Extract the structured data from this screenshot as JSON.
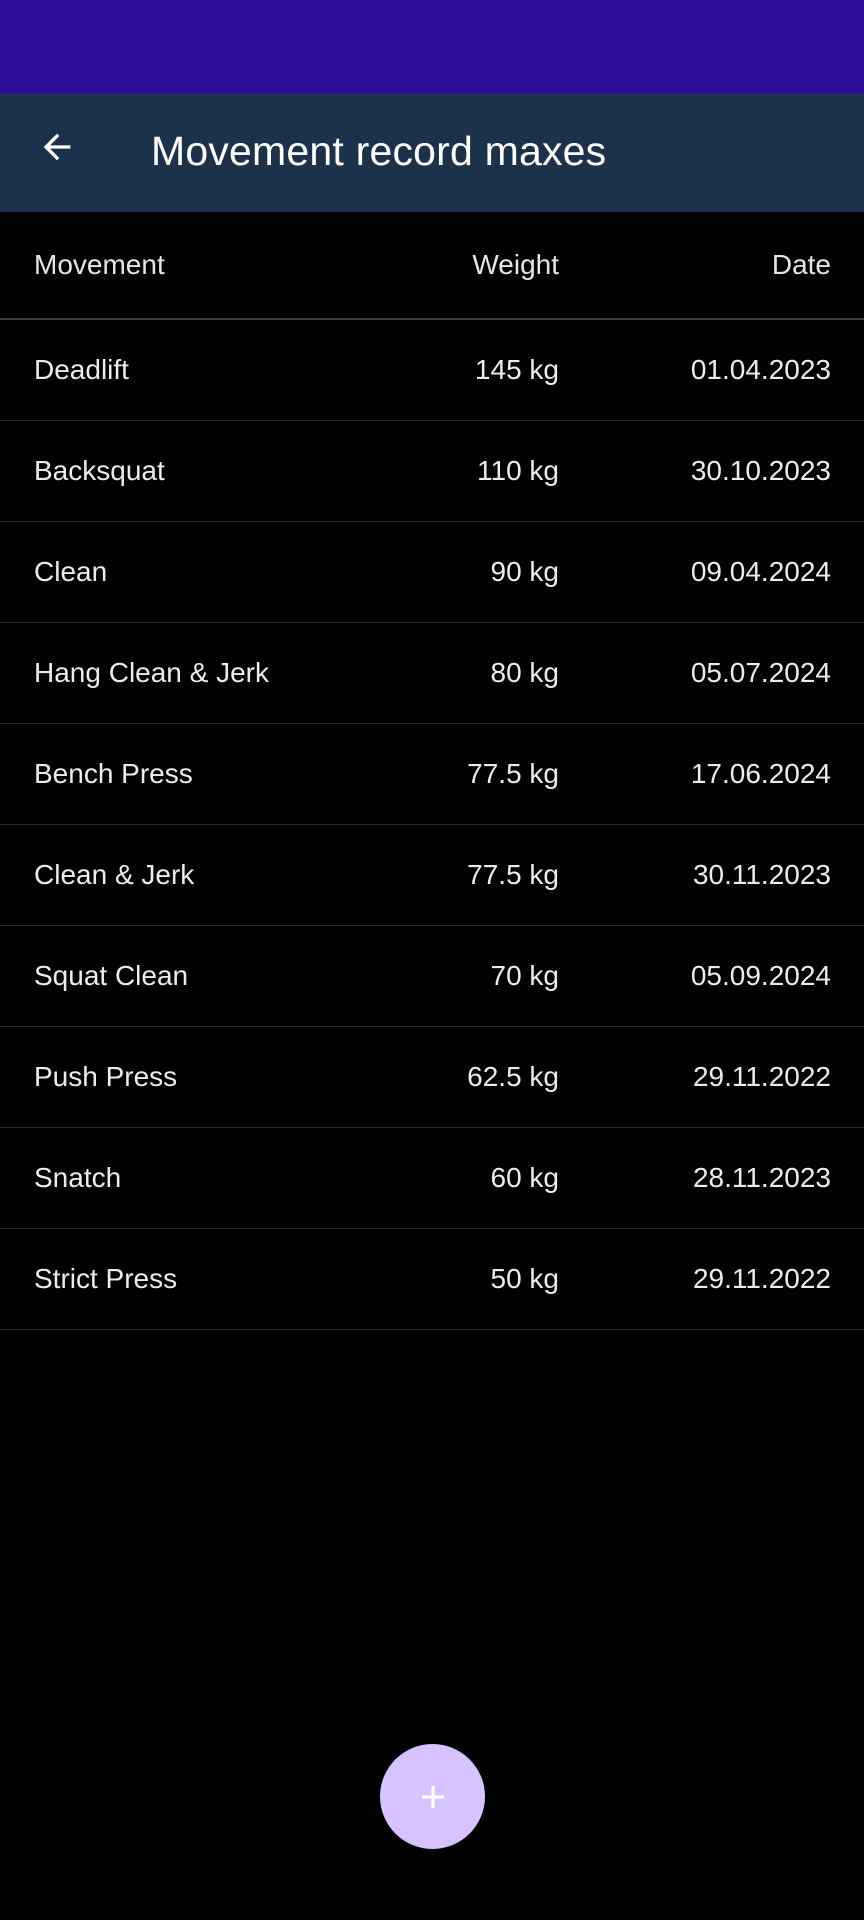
{
  "colors": {
    "status_bar": "#2c0b99",
    "app_bar": "#1c324b",
    "background": "#000000",
    "fab": "#d6c3ff",
    "fab_icon": "#ffffff"
  },
  "header": {
    "title": "Movement record maxes",
    "back_icon": "arrow-left-icon"
  },
  "table": {
    "columns": [
      "Movement",
      "Weight",
      "Date"
    ],
    "rows": [
      {
        "movement": "Deadlift",
        "weight": "145 kg",
        "date": "01.04.2023"
      },
      {
        "movement": "Backsquat",
        "weight": "110 kg",
        "date": "30.10.2023"
      },
      {
        "movement": "Clean",
        "weight": "90 kg",
        "date": "09.04.2024"
      },
      {
        "movement": "Hang Clean & Jerk",
        "weight": "80 kg",
        "date": "05.07.2024"
      },
      {
        "movement": "Bench Press",
        "weight": "77.5 kg",
        "date": "17.06.2024"
      },
      {
        "movement": "Clean & Jerk",
        "weight": "77.5 kg",
        "date": "30.11.2023"
      },
      {
        "movement": "Squat Clean",
        "weight": "70 kg",
        "date": "05.09.2024"
      },
      {
        "movement": "Push Press",
        "weight": "62.5 kg",
        "date": "29.11.2022"
      },
      {
        "movement": "Snatch",
        "weight": "60 kg",
        "date": "28.11.2023"
      },
      {
        "movement": "Strict Press",
        "weight": "50 kg",
        "date": "29.11.2022"
      }
    ]
  },
  "fab": {
    "icon": "plus-icon"
  }
}
